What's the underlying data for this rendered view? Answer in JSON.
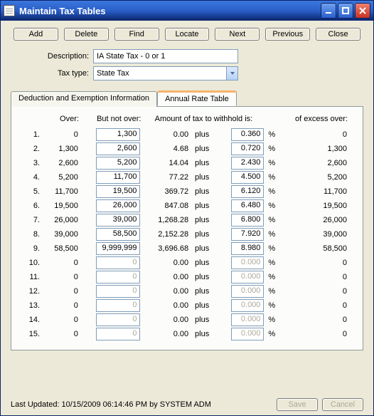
{
  "window": {
    "title": "Maintain Tax Tables"
  },
  "toolbar": {
    "add": "Add",
    "delete": "Delete",
    "find": "Find",
    "locate": "Locate",
    "next": "Next",
    "previous": "Previous",
    "close": "Close"
  },
  "form": {
    "description_label": "Description:",
    "description_value": "IA State Tax - 0 or 1",
    "taxtype_label": "Tax type:",
    "taxtype_value": "State Tax"
  },
  "tabs": {
    "deduction": "Deduction and Exemption Information",
    "annual": "Annual Rate Table"
  },
  "headers": {
    "over": "Over:",
    "butnotover": "But not over:",
    "amount": "Amount of tax to withhold is:",
    "excess": "of excess over:"
  },
  "plus_label": "plus",
  "pct_label": "%",
  "rows": [
    {
      "idx": "1.",
      "over": "0",
      "notover": "1,300",
      "amount": "0.00",
      "rate": "0.360",
      "excess": "0",
      "enabled": true
    },
    {
      "idx": "2.",
      "over": "1,300",
      "notover": "2,600",
      "amount": "4.68",
      "rate": "0.720",
      "excess": "1,300",
      "enabled": true
    },
    {
      "idx": "3.",
      "over": "2,600",
      "notover": "5,200",
      "amount": "14.04",
      "rate": "2.430",
      "excess": "2,600",
      "enabled": true
    },
    {
      "idx": "4.",
      "over": "5,200",
      "notover": "11,700",
      "amount": "77.22",
      "rate": "4.500",
      "excess": "5,200",
      "enabled": true
    },
    {
      "idx": "5.",
      "over": "11,700",
      "notover": "19,500",
      "amount": "369.72",
      "rate": "6.120",
      "excess": "11,700",
      "enabled": true
    },
    {
      "idx": "6.",
      "over": "19,500",
      "notover": "26,000",
      "amount": "847.08",
      "rate": "6.480",
      "excess": "19,500",
      "enabled": true
    },
    {
      "idx": "7.",
      "over": "26,000",
      "notover": "39,000",
      "amount": "1,268.28",
      "rate": "6.800",
      "excess": "26,000",
      "enabled": true
    },
    {
      "idx": "8.",
      "over": "39,000",
      "notover": "58,500",
      "amount": "2,152.28",
      "rate": "7.920",
      "excess": "39,000",
      "enabled": true
    },
    {
      "idx": "9.",
      "over": "58,500",
      "notover": "9,999,999",
      "amount": "3,696.68",
      "rate": "8.980",
      "excess": "58,500",
      "enabled": true
    },
    {
      "idx": "10.",
      "over": "0",
      "notover": "0",
      "amount": "0.00",
      "rate": "0.000",
      "excess": "0",
      "enabled": false
    },
    {
      "idx": "11.",
      "over": "0",
      "notover": "0",
      "amount": "0.00",
      "rate": "0.000",
      "excess": "0",
      "enabled": false
    },
    {
      "idx": "12.",
      "over": "0",
      "notover": "0",
      "amount": "0.00",
      "rate": "0.000",
      "excess": "0",
      "enabled": false
    },
    {
      "idx": "13.",
      "over": "0",
      "notover": "0",
      "amount": "0.00",
      "rate": "0.000",
      "excess": "0",
      "enabled": false
    },
    {
      "idx": "14.",
      "over": "0",
      "notover": "0",
      "amount": "0.00",
      "rate": "0.000",
      "excess": "0",
      "enabled": false
    },
    {
      "idx": "15.",
      "over": "0",
      "notover": "0",
      "amount": "0.00",
      "rate": "0.000",
      "excess": "0",
      "enabled": false
    }
  ],
  "footer": {
    "status": "Last Updated: 10/15/2009 06:14:46 PM by SYSTEM ADM",
    "save": "Save",
    "cancel": "Cancel"
  }
}
